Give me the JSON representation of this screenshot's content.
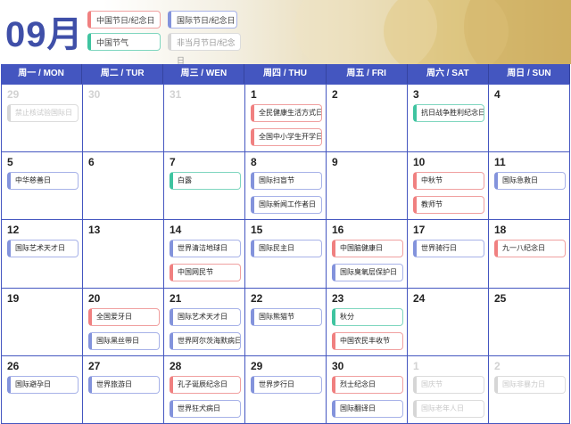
{
  "month_label": "09月",
  "legend": {
    "cn": "中国节日/纪念日",
    "intl": "国际节日/纪念日",
    "term": "中国节气",
    "other": "非当月节日/纪念日"
  },
  "weekdays": [
    "周一 / MON",
    "周二 / TUR",
    "周三 / WEN",
    "周四 / THU",
    "周五 / FRI",
    "周六 / SAT",
    "周日 / SUN"
  ],
  "cells": [
    {
      "day": "29",
      "other": true,
      "events": [
        {
          "text": "禁止核试验国际日",
          "kind": "other"
        }
      ]
    },
    {
      "day": "30",
      "other": true,
      "events": []
    },
    {
      "day": "31",
      "other": true,
      "events": []
    },
    {
      "day": "1",
      "other": false,
      "events": [
        {
          "text": "全民健康生活方式日",
          "kind": "cn"
        },
        {
          "text": "全国中小学生开学日",
          "kind": "cn"
        }
      ]
    },
    {
      "day": "2",
      "other": false,
      "events": []
    },
    {
      "day": "3",
      "other": false,
      "events": [
        {
          "text": "抗日战争胜利纪念日",
          "kind": "term"
        }
      ]
    },
    {
      "day": "4",
      "other": false,
      "events": []
    },
    {
      "day": "5",
      "other": false,
      "events": [
        {
          "text": "中华慈善日",
          "kind": "intl"
        }
      ]
    },
    {
      "day": "6",
      "other": false,
      "events": []
    },
    {
      "day": "7",
      "other": false,
      "events": [
        {
          "text": "白露",
          "kind": "term"
        }
      ]
    },
    {
      "day": "8",
      "other": false,
      "events": [
        {
          "text": "国际扫盲节",
          "kind": "intl"
        },
        {
          "text": "国际新闻工作者日",
          "kind": "intl"
        }
      ]
    },
    {
      "day": "9",
      "other": false,
      "events": []
    },
    {
      "day": "10",
      "other": false,
      "events": [
        {
          "text": "中秋节",
          "kind": "cn"
        },
        {
          "text": "教师节",
          "kind": "cn"
        }
      ]
    },
    {
      "day": "11",
      "other": false,
      "events": [
        {
          "text": "国际急救日",
          "kind": "intl"
        }
      ]
    },
    {
      "day": "12",
      "other": false,
      "events": [
        {
          "text": "国际艺术天才日",
          "kind": "intl"
        }
      ]
    },
    {
      "day": "13",
      "other": false,
      "events": []
    },
    {
      "day": "14",
      "other": false,
      "events": [
        {
          "text": "世界清洁地球日",
          "kind": "intl"
        },
        {
          "text": "中国网民节",
          "kind": "cn"
        }
      ]
    },
    {
      "day": "15",
      "other": false,
      "events": [
        {
          "text": "国际民主日",
          "kind": "intl"
        }
      ]
    },
    {
      "day": "16",
      "other": false,
      "events": [
        {
          "text": "中国脑健康日",
          "kind": "cn"
        },
        {
          "text": "国际臭氧层保护日",
          "kind": "intl"
        }
      ]
    },
    {
      "day": "17",
      "other": false,
      "events": [
        {
          "text": "世界骑行日",
          "kind": "intl"
        }
      ]
    },
    {
      "day": "18",
      "other": false,
      "events": [
        {
          "text": "九一八纪念日",
          "kind": "cn"
        }
      ]
    },
    {
      "day": "19",
      "other": false,
      "events": []
    },
    {
      "day": "20",
      "other": false,
      "events": [
        {
          "text": "全国爱牙日",
          "kind": "cn"
        },
        {
          "text": "国际黑丝带日",
          "kind": "intl"
        }
      ]
    },
    {
      "day": "21",
      "other": false,
      "events": [
        {
          "text": "国际艺术天才日",
          "kind": "intl"
        },
        {
          "text": "世界阿尔茨海默病日",
          "kind": "intl"
        }
      ]
    },
    {
      "day": "22",
      "other": false,
      "events": [
        {
          "text": "国际熊猫节",
          "kind": "intl"
        }
      ]
    },
    {
      "day": "23",
      "other": false,
      "events": [
        {
          "text": "秋分",
          "kind": "term"
        },
        {
          "text": "中国农民丰收节",
          "kind": "cn"
        }
      ]
    },
    {
      "day": "24",
      "other": false,
      "events": []
    },
    {
      "day": "25",
      "other": false,
      "events": []
    },
    {
      "day": "26",
      "other": false,
      "events": [
        {
          "text": "国际避孕日",
          "kind": "intl"
        }
      ]
    },
    {
      "day": "27",
      "other": false,
      "events": [
        {
          "text": "世界旅游日",
          "kind": "intl"
        }
      ]
    },
    {
      "day": "28",
      "other": false,
      "events": [
        {
          "text": "孔子诞辰纪念日",
          "kind": "cn"
        },
        {
          "text": "世界狂犬病日",
          "kind": "intl"
        }
      ]
    },
    {
      "day": "29",
      "other": false,
      "events": [
        {
          "text": "世界步行日",
          "kind": "intl"
        }
      ]
    },
    {
      "day": "30",
      "other": false,
      "events": [
        {
          "text": "烈士纪念日",
          "kind": "cn"
        },
        {
          "text": "国际翻译日",
          "kind": "intl"
        }
      ]
    },
    {
      "day": "1",
      "other": true,
      "events": [
        {
          "text": "国庆节",
          "kind": "other"
        },
        {
          "text": "国际老年人日",
          "kind": "other"
        }
      ]
    },
    {
      "day": "2",
      "other": true,
      "events": [
        {
          "text": "国际非暴力日",
          "kind": "other"
        }
      ]
    }
  ]
}
